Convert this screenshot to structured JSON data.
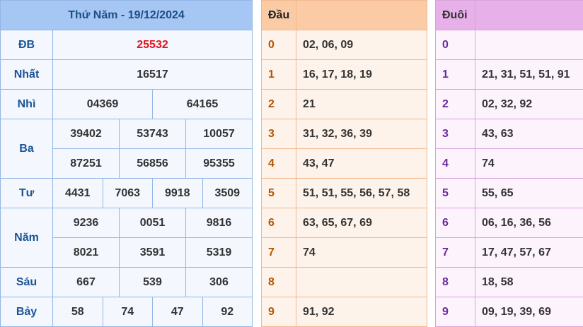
{
  "title": "Thứ Năm - 19/12/2024",
  "prizes": {
    "db": {
      "label": "ĐB",
      "numbers": [
        "25532"
      ]
    },
    "nhat": {
      "label": "Nhất",
      "numbers": [
        "16517"
      ]
    },
    "nhi": {
      "label": "Nhì",
      "numbers": [
        "04369",
        "64165"
      ]
    },
    "ba": {
      "label": "Ba",
      "numbers": [
        "39402",
        "53743",
        "10057",
        "87251",
        "56856",
        "95355"
      ]
    },
    "tu": {
      "label": "Tư",
      "numbers": [
        "4431",
        "7063",
        "9918",
        "3509"
      ]
    },
    "nam": {
      "label": "Năm",
      "numbers": [
        "9236",
        "0051",
        "9816",
        "8021",
        "3591",
        "5319"
      ]
    },
    "sau": {
      "label": "Sáu",
      "numbers": [
        "667",
        "539",
        "306"
      ]
    },
    "bay": {
      "label": "Bảy",
      "numbers": [
        "58",
        "74",
        "47",
        "92"
      ]
    }
  },
  "dau": {
    "header": "Đầu",
    "rows": [
      {
        "key": "0",
        "values": "02, 06, 09"
      },
      {
        "key": "1",
        "values": "16, 17, 18, 19"
      },
      {
        "key": "2",
        "values": "21"
      },
      {
        "key": "3",
        "values": "31, 32, 36, 39"
      },
      {
        "key": "4",
        "values": "43, 47"
      },
      {
        "key": "5",
        "values": "51, 51, 55, 56, 57, 58"
      },
      {
        "key": "6",
        "values": "63, 65, 67, 69"
      },
      {
        "key": "7",
        "values": "74"
      },
      {
        "key": "8",
        "values": ""
      },
      {
        "key": "9",
        "values": "91, 92"
      }
    ]
  },
  "duoi": {
    "header": "Đuôi",
    "rows": [
      {
        "key": "0",
        "values": ""
      },
      {
        "key": "1",
        "values": "21, 31, 51, 51, 91"
      },
      {
        "key": "2",
        "values": "02, 32, 92"
      },
      {
        "key": "3",
        "values": "43, 63"
      },
      {
        "key": "4",
        "values": "74"
      },
      {
        "key": "5",
        "values": "55, 65"
      },
      {
        "key": "6",
        "values": "06, 16, 36, 56"
      },
      {
        "key": "7",
        "values": "17, 47, 57, 67"
      },
      {
        "key": "8",
        "values": "18, 58"
      },
      {
        "key": "9",
        "values": "09, 19, 39, 69"
      }
    ]
  }
}
